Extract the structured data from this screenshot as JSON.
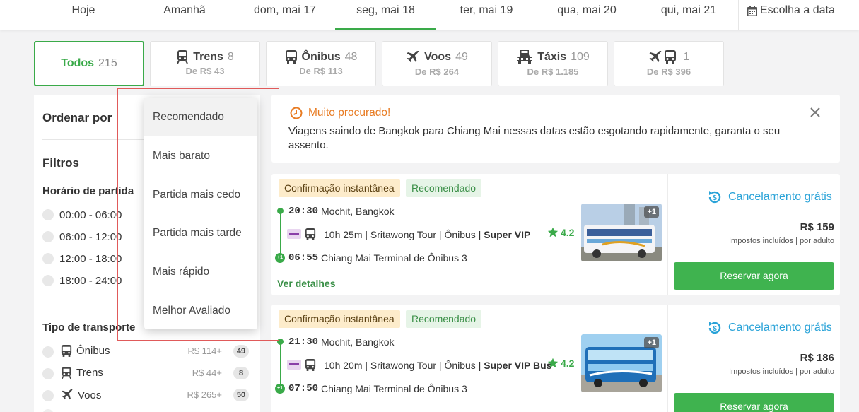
{
  "date_bar": {
    "tabs": [
      {
        "label": "Hoje"
      },
      {
        "label": "Amanhã"
      },
      {
        "label": "dom, mai 17"
      },
      {
        "label": "seg, mai 18"
      },
      {
        "label": "ter, mai 19"
      },
      {
        "label": "qua, mai 20"
      },
      {
        "label": "qui, mai 21"
      }
    ],
    "active_tab": "seg, mai 18",
    "choose_date": "Escolha a data"
  },
  "mode_tabs": [
    {
      "label": "Todos",
      "count": "215",
      "price": "",
      "icon": ""
    },
    {
      "label": "Trens",
      "count": "8",
      "price": "De R$ 43",
      "icon": "train-icon"
    },
    {
      "label": "Ônibus",
      "count": "48",
      "price": "De R$ 113",
      "icon": "bus-icon"
    },
    {
      "label": "Voos",
      "count": "49",
      "price": "De R$ 264",
      "icon": "plane-icon"
    },
    {
      "label": "Táxis",
      "count": "109",
      "price": "De R$ 1.185",
      "icon": "taxi-icon"
    },
    {
      "label": "",
      "count": "1",
      "price": "De R$ 396",
      "icon": "plane-bus-icon"
    }
  ],
  "sidebar": {
    "sort_label": "Ordenar por",
    "filters_label": "Filtros",
    "departure_label": "Horário de partida",
    "time_ranges": [
      "00:00 - 06:00",
      "06:00 - 12:00",
      "12:00 - 18:00",
      "18:00 - 24:00"
    ],
    "transport_label": "Tipo de transporte",
    "transport_types": [
      {
        "name": "Ônibus",
        "price": "R$ 114+",
        "count": "49",
        "icon": "bus-icon"
      },
      {
        "name": "Trens",
        "price": "R$ 44+",
        "count": "8",
        "icon": "train-icon"
      },
      {
        "name": "Voos",
        "price": "R$ 265+",
        "count": "50",
        "icon": "plane-icon"
      }
    ]
  },
  "sort_dropdown": {
    "options": [
      "Recomendado",
      "Mais barato",
      "Partida mais cedo",
      "Partida mais tarde",
      "Mais rápido",
      "Melhor Avaliado"
    ],
    "selected": "Recomendado"
  },
  "alert": {
    "title": "Muito procurado!",
    "text": "Viagens saindo de Bangkok para Chiang Mai nessas datas estão esgotando rapidamente, garanta o seu assento."
  },
  "results": [
    {
      "badges": [
        "Confirmação instantânea",
        "Recomendado"
      ],
      "depart_time": "20:30",
      "depart_place": "Mochit, Bangkok",
      "info": "10h 25m | Sritawong Tour | Ônibus | ",
      "bus_class": "Super VIP",
      "rating": "4.2",
      "arrive_day_offset": "+1",
      "arrive_time": "06:55",
      "arrive_place": "Chiang Mai Terminal de Ônibus 3",
      "photos_more": "+1",
      "details_link": "Ver detalhes",
      "cancellation": "Cancelamento grátis",
      "price": "R$ 159",
      "tax_note": "Impostos incluídos | por adulto",
      "book_label": "Reservar agora"
    },
    {
      "badges": [
        "Confirmação instantânea",
        "Recomendado"
      ],
      "depart_time": "21:30",
      "depart_place": "Mochit, Bangkok",
      "info": "10h 20m | Sritawong Tour | Ônibus | ",
      "bus_class": "Super VIP Bus",
      "rating": "4.2",
      "arrive_day_offset": "+1",
      "arrive_time": "07:50",
      "arrive_place": "Chiang Mai Terminal de Ônibus 3",
      "photos_more": "+1",
      "details_link": "Ver detalhes",
      "cancellation": "Cancelamento grátis",
      "price": "R$ 186",
      "tax_note": "Impostos incluídos | por adulto",
      "book_label": "Reservar agora"
    }
  ],
  "colors": {
    "accent": "#3aaa49",
    "alert": "#e87b22",
    "link_blue": "#2aa3d8",
    "highlight_box": "#e05a5a"
  }
}
